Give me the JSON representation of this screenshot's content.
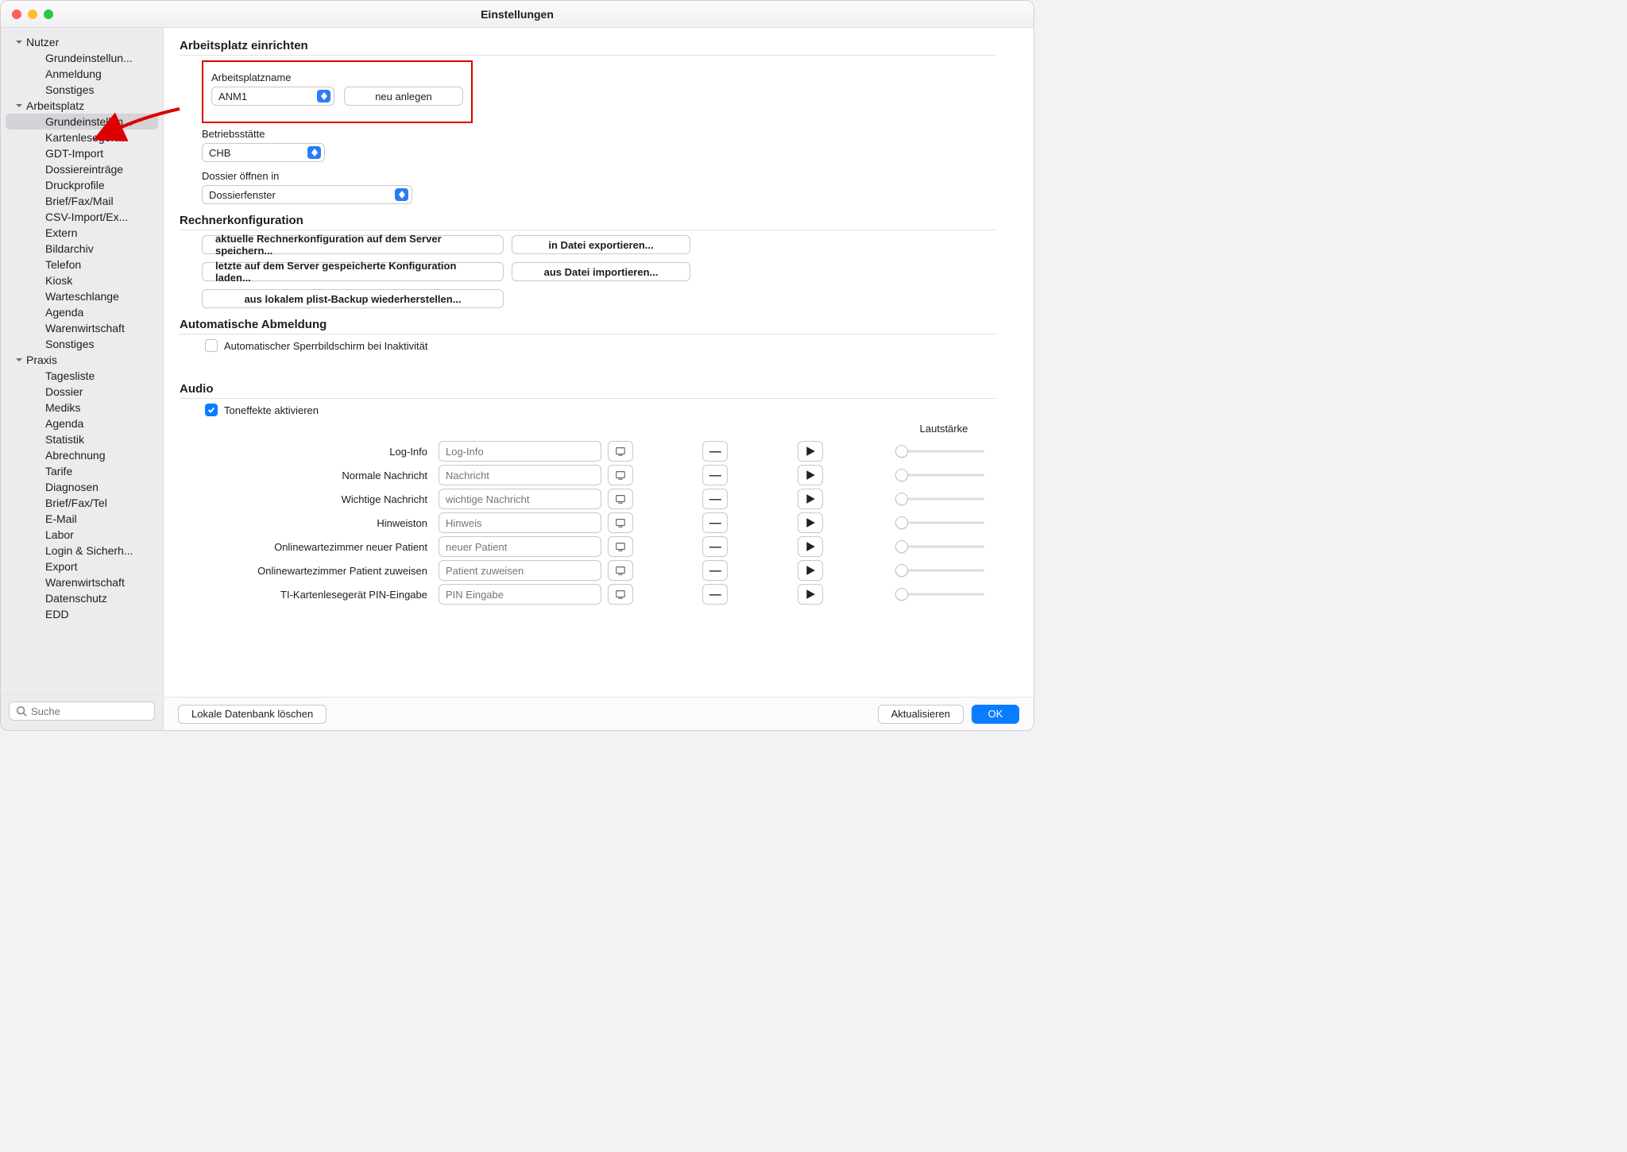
{
  "window": {
    "title": "Einstellungen"
  },
  "sidebar": {
    "groups": [
      {
        "label": "Nutzer",
        "items": [
          "Grundeinstellun...",
          "Anmeldung",
          "Sonstiges"
        ]
      },
      {
        "label": "Arbeitsplatz",
        "items": [
          "Grundeinstellun...",
          "Kartenlesegerät",
          "GDT-Import",
          "Dossiereinträge",
          "Druckprofile",
          "Brief/Fax/Mail",
          "CSV-Import/Ex...",
          "Extern",
          "Bildarchiv",
          "Telefon",
          "Kiosk",
          "Warteschlange",
          "Agenda",
          "Warenwirtschaft",
          "Sonstiges"
        ]
      },
      {
        "label": "Praxis",
        "items": [
          "Tagesliste",
          "Dossier",
          "Mediks",
          "Agenda",
          "Statistik",
          "Abrechnung",
          "Tarife",
          "Diagnosen",
          "Brief/Fax/Tel",
          "E-Mail",
          "Labor",
          "Login & Sicherh...",
          "Export",
          "Warenwirtschaft",
          "Datenschutz",
          "EDD"
        ]
      }
    ],
    "selected_group": 1,
    "selected_item": 0,
    "search_placeholder": "Suche"
  },
  "section_setup": {
    "title": "Arbeitsplatz einrichten",
    "name_label": "Arbeitsplatzname",
    "name_value": "ANM1",
    "new_button": "neu anlegen",
    "site_label": "Betriebsstätte",
    "site_value": "CHB",
    "open_label": "Dossier öffnen in",
    "open_value": "Dossierfenster"
  },
  "section_config": {
    "title": "Rechnerkonfiguration",
    "btn_save": "aktuelle Rechnerkonfiguration auf dem Server speichern...",
    "btn_export": "in Datei exportieren...",
    "btn_load": "letzte auf dem Server gespeicherte Konfiguration laden...",
    "btn_import": "aus Datei importieren...",
    "btn_plist": "aus lokalem plist-Backup wiederherstellen..."
  },
  "section_logout": {
    "title": "Automatische Abmeldung",
    "chk_label": "Automatischer Sperrbildschirm bei Inaktivität",
    "chk_value": false
  },
  "section_audio": {
    "title": "Audio",
    "chk_label": "Toneffekte aktivieren",
    "chk_value": true,
    "vol_label": "Lautstärke",
    "rows": [
      {
        "label": "Log-Info",
        "placeholder": "Log-Info"
      },
      {
        "label": "Normale Nachricht",
        "placeholder": "Nachricht"
      },
      {
        "label": "Wichtige Nachricht",
        "placeholder": "wichtige Nachricht"
      },
      {
        "label": "Hinweiston",
        "placeholder": "Hinweis"
      },
      {
        "label": "Onlinewartezimmer neuer Patient",
        "placeholder": "neuer Patient"
      },
      {
        "label": "Onlinewartezimmer Patient zuweisen",
        "placeholder": "Patient zuweisen"
      },
      {
        "label": "TI-Kartenlesegerät PIN-Eingabe",
        "placeholder": "PIN Eingabe"
      }
    ]
  },
  "footer": {
    "btn_clear": "Lokale Datenbank löschen",
    "btn_refresh": "Aktualisieren",
    "btn_ok": "OK"
  }
}
